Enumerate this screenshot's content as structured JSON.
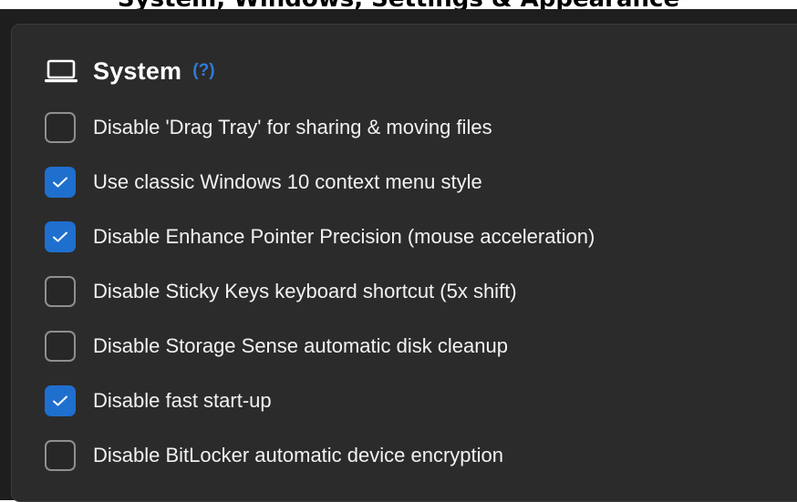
{
  "top_strip": {
    "text": "System, Windows, Settings & Appearance"
  },
  "section": {
    "title": "System",
    "help": "(?)",
    "icon": "laptop-icon"
  },
  "options": [
    {
      "label": "Disable 'Drag Tray' for sharing & moving files",
      "checked": false
    },
    {
      "label": "Use classic Windows 10 context menu style",
      "checked": true
    },
    {
      "label": "Disable Enhance Pointer Precision (mouse acceleration)",
      "checked": true
    },
    {
      "label": "Disable Sticky Keys keyboard shortcut (5x shift)",
      "checked": false
    },
    {
      "label": "Disable Storage Sense automatic disk cleanup",
      "checked": false
    },
    {
      "label": "Disable fast start-up",
      "checked": true
    },
    {
      "label": "Disable BitLocker automatic device encryption",
      "checked": false
    }
  ],
  "colors": {
    "background": "#1e1e1e",
    "card": "#2b2b2b",
    "accent": "#1f6fcf",
    "help_link": "#2f7bd8",
    "text": "#f2f2f2"
  }
}
